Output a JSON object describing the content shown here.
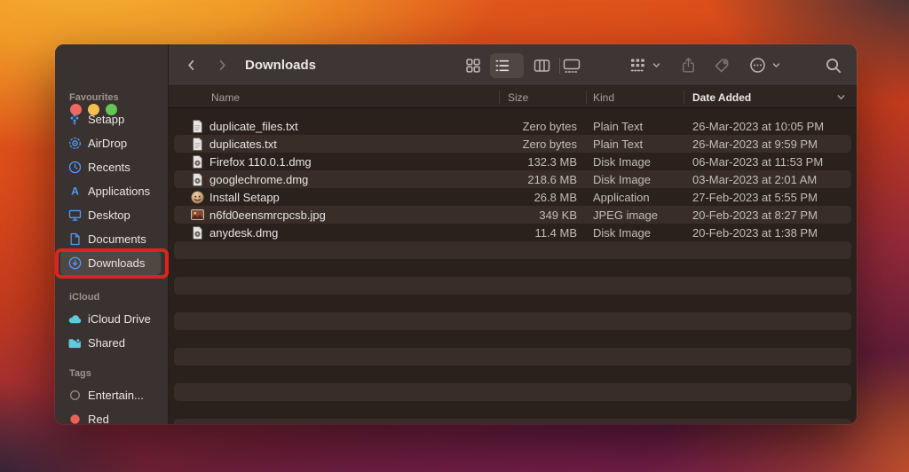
{
  "window": {
    "title": "Downloads"
  },
  "traffic_lights": {
    "close": "red",
    "minimize": "yellow",
    "zoom": "green"
  },
  "toolbar": {
    "back": "back",
    "forward": "forward",
    "view_modes": [
      "icon-view",
      "list-view",
      "column-view",
      "gallery-view"
    ],
    "selected_view": "list-view",
    "actions": [
      "group-by",
      "share",
      "tag",
      "more-actions",
      "search"
    ]
  },
  "sidebar": {
    "sections": [
      {
        "label": "Favourites",
        "items": [
          {
            "label": "Setapp",
            "icon": "setapp-icon",
            "tint": "blue"
          },
          {
            "label": "AirDrop",
            "icon": "airdrop-icon",
            "tint": "blue"
          },
          {
            "label": "Recents",
            "icon": "recents-icon",
            "tint": "blue"
          },
          {
            "label": "Applications",
            "icon": "applications-icon",
            "tint": "blue"
          },
          {
            "label": "Desktop",
            "icon": "desktop-icon",
            "tint": "blue"
          },
          {
            "label": "Documents",
            "icon": "documents-icon",
            "tint": "blue"
          },
          {
            "label": "Downloads",
            "icon": "downloads-icon",
            "tint": "blue",
            "selected": true,
            "annotated": true
          }
        ]
      },
      {
        "label": "iCloud",
        "items": [
          {
            "label": "iCloud Drive",
            "icon": "icloud-drive-icon",
            "tint": "cyan"
          },
          {
            "label": "Shared",
            "icon": "shared-folder-icon",
            "tint": "cyan"
          }
        ]
      },
      {
        "label": "Tags",
        "items": [
          {
            "label": "Entertain...",
            "icon": "tag-circle-gray-icon",
            "tint": "gray"
          },
          {
            "label": "Red",
            "icon": "tag-circle-red-icon",
            "tint": "red"
          }
        ]
      }
    ]
  },
  "table": {
    "columns": [
      {
        "label": "Name",
        "sorted": false
      },
      {
        "label": "Size",
        "sorted": false
      },
      {
        "label": "Kind",
        "sorted": false
      },
      {
        "label": "Date Added",
        "sorted": true,
        "sort_direction": "descending"
      }
    ],
    "rows": [
      {
        "name": "duplicate_files.txt",
        "size": "Zero bytes",
        "kind": "Plain Text",
        "date_added": "26-Mar-2023 at 10:05 PM",
        "icon": "text-file-icon"
      },
      {
        "name": "duplicates.txt",
        "size": "Zero bytes",
        "kind": "Plain Text",
        "date_added": "26-Mar-2023 at 9:59 PM",
        "icon": "text-file-icon"
      },
      {
        "name": "Firefox 110.0.1.dmg",
        "size": "132.3 MB",
        "kind": "Disk Image",
        "date_added": "06-Mar-2023 at 11:53 PM",
        "icon": "disk-image-icon"
      },
      {
        "name": "googlechrome.dmg",
        "size": "218.6 MB",
        "kind": "Disk Image",
        "date_added": "03-Mar-2023 at 2:01 AM",
        "icon": "disk-image-icon"
      },
      {
        "name": "Install Setapp",
        "size": "26.8 MB",
        "kind": "Application",
        "date_added": "27-Feb-2023 at 5:55 PM",
        "icon": "setapp-app-icon"
      },
      {
        "name": "n6fd0eensmrcpcsb.jpg",
        "size": "349 KB",
        "kind": "JPEG image",
        "date_added": "20-Feb-2023 at 8:27 PM",
        "icon": "jpeg-thumbnail-icon"
      },
      {
        "name": "anydesk.dmg",
        "size": "11.4 MB",
        "kind": "Disk Image",
        "date_added": "20-Feb-2023 at 1:38 PM",
        "icon": "disk-image-icon"
      }
    ]
  },
  "colors": {
    "accent_blue": "#4f9cf6",
    "icloud_cyan": "#5fc9de",
    "annotation_red": "#e0221e",
    "tag_red": "#ee5f55",
    "traffic_red": "#ee6a5e",
    "traffic_yellow": "#f5bf4f",
    "traffic_green": "#62c554",
    "row_dark": "#2b211c",
    "row_light": "#382d27"
  }
}
